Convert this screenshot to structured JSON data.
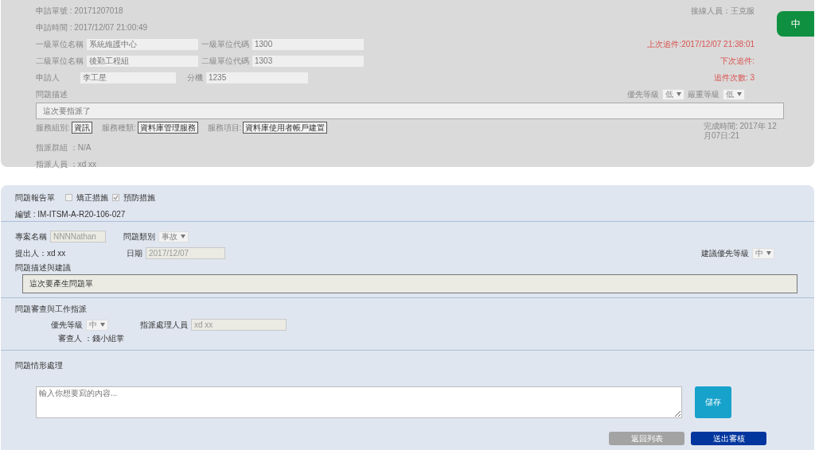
{
  "request": {
    "number": "申請單號 : 20171207018",
    "time": "申請時間 : 2017/12/07 21:00:49",
    "handler": "接線人員：王克服",
    "status_tab": "中",
    "units": [
      {
        "name_label": "一級單位名稱",
        "name_value": "系統維護中心",
        "code_label": "一級單位代碼",
        "code_value": "1300"
      },
      {
        "name_label": "二級單位名稱",
        "name_value": "後勤工程組",
        "code_label": "二級單位代碼",
        "code_value": "1303"
      }
    ],
    "applicant": {
      "label": "申請人",
      "value": "李工星",
      "ext_label": "分機",
      "ext_value": "1235"
    },
    "followups": [
      "上次追件:2017/12/07 21:38:01",
      "下次追件:",
      "追件次數: 3"
    ],
    "description_label": "問題描述",
    "levels": [
      {
        "label": "優先等級",
        "value": "低"
      },
      {
        "label": "嚴重等級",
        "value": "低"
      }
    ],
    "description": "這次要指派了",
    "services": [
      {
        "label": "服務組別:",
        "value": "資訊"
      },
      {
        "label": "服務種類:",
        "value": "資料庫管理服務"
      },
      {
        "label": "服務項目:",
        "value": "資料庫使用者帳戶建置"
      }
    ],
    "completion": "完成時間: 2017年 12月07日:21",
    "assign_group": "指派群組 ：N/A",
    "assignee": "指派人員 ：xd xx"
  },
  "report": {
    "title": "問題報告單",
    "checkboxes": [
      {
        "label": "矯正措施",
        "checked": false
      },
      {
        "label": "預防措施",
        "checked": true
      }
    ],
    "number": "編號 : IM-ITSM-A-R20-106-027",
    "project": {
      "label": "專案名稱",
      "value": "NNNNathan"
    },
    "category": {
      "label": "問題類別",
      "value": "事故"
    },
    "proposer": "提出人：xd xx",
    "date": {
      "label": "日期",
      "value": "2017/12/07"
    },
    "suggested_priority": {
      "label": "建議優先等級",
      "value": "中"
    },
    "description_label": "問題描述與建議",
    "description": "這次要產生問題單"
  },
  "review": {
    "title": "問題審查與工作指派",
    "priority": {
      "label": "優先等級",
      "value": "中"
    },
    "handler": {
      "label": "指派處理人員",
      "value": "xd xx"
    },
    "reviewer": "審查人 ：錢小組掌"
  },
  "handling": {
    "title": "問題情形處理",
    "placeholder": "輸入你想要寫的內容...",
    "save": "儲存",
    "buttons": [
      {
        "label": "返回列表",
        "kind": "secondary"
      },
      {
        "label": "送出審核",
        "kind": "primary"
      }
    ]
  }
}
